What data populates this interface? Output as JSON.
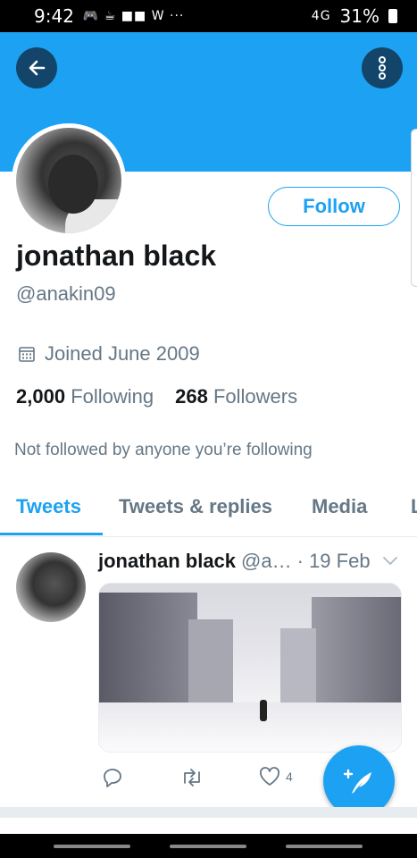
{
  "status_bar": {
    "time": "9:42",
    "left_icons": "🎮 ☕ ■■ W ···",
    "network": "4G",
    "battery": "31%"
  },
  "profile": {
    "name": "jonathan black",
    "handle": "@anakin09",
    "follow_label": "Follow",
    "joined": "Joined June 2009",
    "following_count": "2,000",
    "following_label": "Following",
    "followers_count": "268",
    "followers_label": "Followers",
    "not_followed": "Not followed by anyone you’re following"
  },
  "tabs": [
    {
      "label": "Tweets",
      "active": true
    },
    {
      "label": "Tweets & replies",
      "active": false
    },
    {
      "label": "Media",
      "active": false
    },
    {
      "label": "L",
      "active": false
    }
  ],
  "tweet": {
    "name": "jonathan black",
    "handle": "@a…",
    "date": "· 19 Feb",
    "like_count": "4"
  },
  "colors": {
    "brand": "#1da1f2",
    "banner": "#1da1f2",
    "icon_button_bg": "#13456b",
    "secondary_text": "#657786"
  }
}
